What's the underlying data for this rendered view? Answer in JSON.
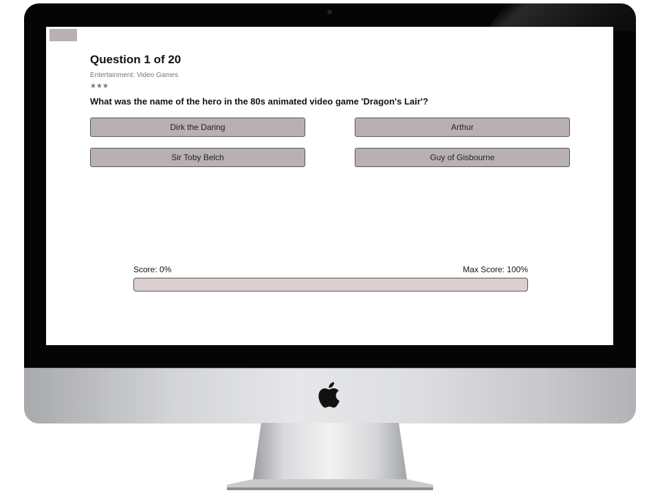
{
  "quiz": {
    "question_title": "Question 1 of 20",
    "category": "Entertainment: Video Games",
    "difficulty_stars": "★★★",
    "question_text": "What was the name of the hero in the 80s animated video game 'Dragon's Lair'?",
    "answers": [
      {
        "label": "Dirk the Daring"
      },
      {
        "label": "Arthur"
      },
      {
        "label": "Sir Toby Belch"
      },
      {
        "label": "Guy of Gisbourne"
      }
    ],
    "score_label": "Score: 0%",
    "max_score_label": "Max Score: 100%",
    "score_progress_percent": 0
  },
  "colors": {
    "answer_bg": "#b9b0b1",
    "progress_bg": "#dccfd0",
    "bezel": "#050505"
  },
  "icons": {
    "logo": "apple-logo-icon",
    "camera": "camera-icon"
  }
}
